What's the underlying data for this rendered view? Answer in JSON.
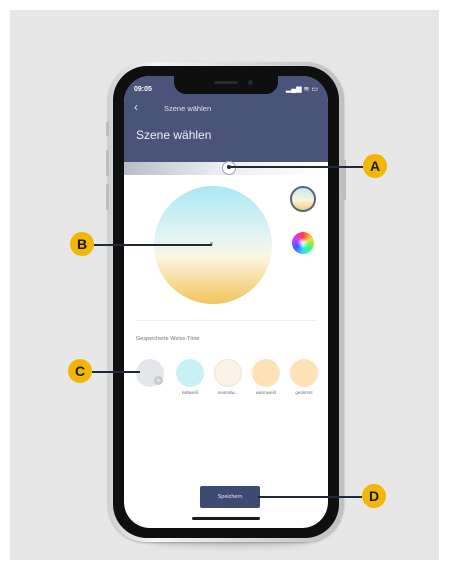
{
  "status_bar": {
    "time": "09:05",
    "icons": "▂▄▆ ≋ ▭"
  },
  "nav": {
    "back_icon": "‹",
    "title": "Szene wählen"
  },
  "page": {
    "title": "Szene wählen"
  },
  "saved": {
    "label": "Gespeicherte Weiss-Töne",
    "swatches": [
      {
        "label": "",
        "color": "#e5e6e9"
      },
      {
        "label": "kaltweiß",
        "color": "#c8f0f6"
      },
      {
        "label": "neutralw...",
        "color": "#fbf2e6"
      },
      {
        "label": "warmweiß",
        "color": "#fde2b8"
      },
      {
        "label": "gedimmt",
        "color": "#fde2b8"
      }
    ]
  },
  "save_button": {
    "label": "Speichern"
  },
  "callouts": {
    "a": "A",
    "b": "B",
    "c": "C",
    "d": "D"
  },
  "colors": {
    "header": "#4a5478",
    "button": "#3d4a72",
    "callout": "#f2b705"
  }
}
